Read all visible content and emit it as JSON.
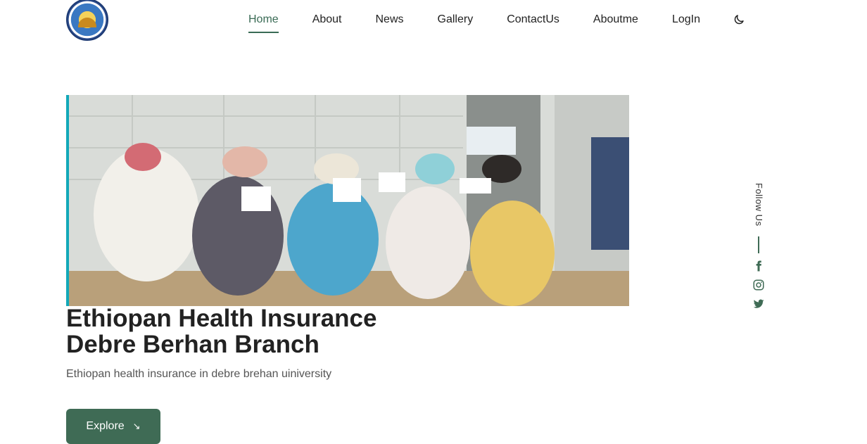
{
  "nav": {
    "items": [
      {
        "label": "Home"
      },
      {
        "label": "About"
      },
      {
        "label": "News"
      },
      {
        "label": "Gallery"
      },
      {
        "label": "ContactUs"
      },
      {
        "label": "Aboutme"
      },
      {
        "label": "LogIn"
      }
    ],
    "active": "Home",
    "theme_icon": "moon-icon"
  },
  "hero": {
    "title_line1": "Ethiopan Health Insurance",
    "title_line2": "Debre Berhan Branch",
    "subtitle": "Ethiopan health insurance in debre brehan uiniversity",
    "button_label": "Explore",
    "button_icon": "arrow-down-right-icon"
  },
  "follow": {
    "label": "Follow Us",
    "icons": [
      "facebook-icon",
      "instagram-icon",
      "twitter-icon"
    ]
  },
  "colors": {
    "accent": "#3f6b55",
    "image_border": "#12a8b8"
  }
}
